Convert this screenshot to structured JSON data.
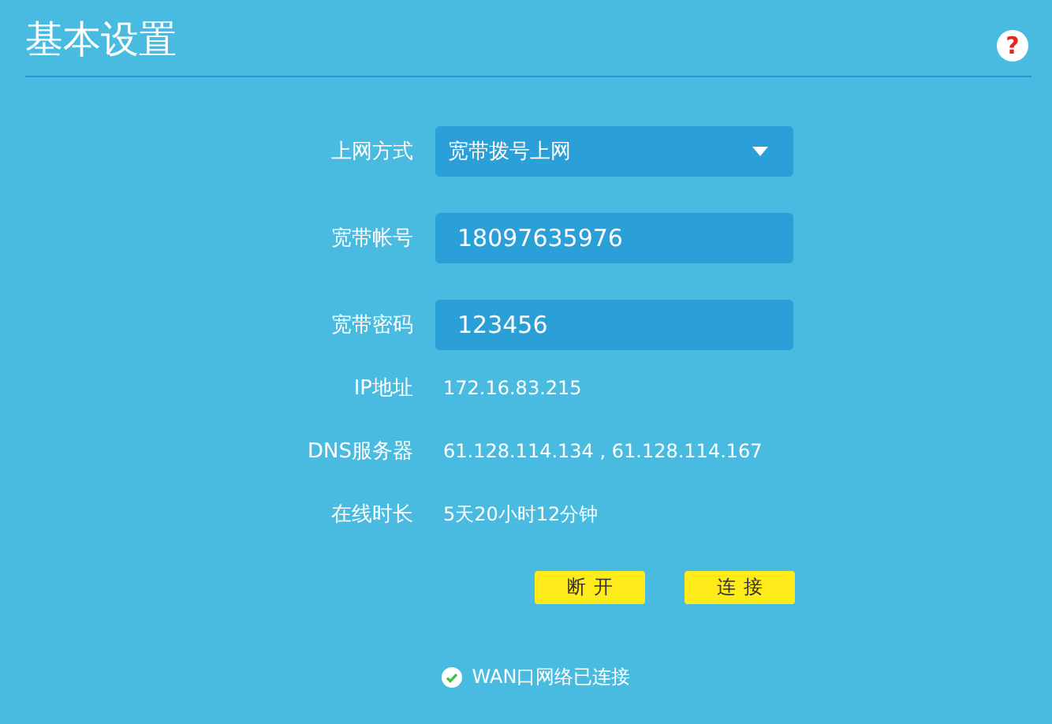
{
  "title": "基本设置",
  "help": {
    "text": "?"
  },
  "fields": [
    {
      "kind": "select",
      "label": "上网方式",
      "value": "宽带拨号上网"
    },
    {
      "kind": "input",
      "label": "宽带帐号",
      "value": "18097635976"
    },
    {
      "kind": "input",
      "label": "宽带密码",
      "value": "123456"
    }
  ],
  "info": [
    {
      "label": "IP地址",
      "value": "172.16.83.215"
    },
    {
      "label": "DNS服务器",
      "value": "61.128.114.134 , 61.128.114.167"
    },
    {
      "label": "在线时长",
      "value": "5天20小时12分钟"
    }
  ],
  "buttons": [
    "断开",
    "连接"
  ],
  "status": {
    "text": "WAN口网络已连接",
    "connected": true
  }
}
